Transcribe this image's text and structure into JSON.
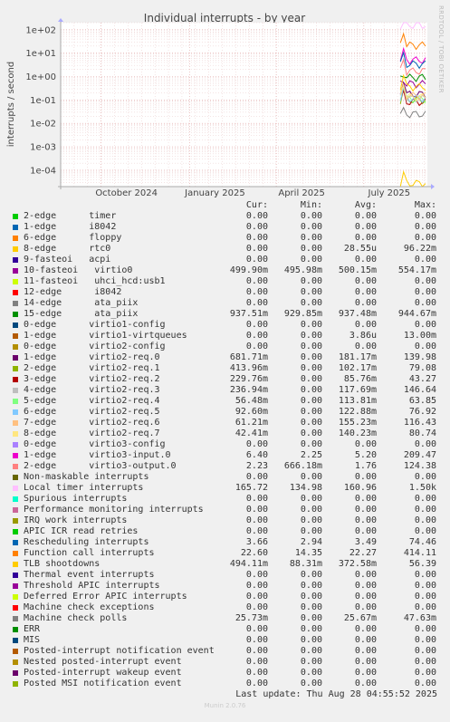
{
  "chart_data": {
    "type": "line",
    "title": "Individual interrupts - by year",
    "ylabel": "interrupts / second",
    "yscale": "log",
    "ylim": [
      2e-05,
      200
    ],
    "yticks": [
      "1e+02",
      "1e+01",
      "1e+00",
      "1e-01",
      "1e-02",
      "1e-03",
      "1e-04"
    ],
    "xticks": [
      "October 2024",
      "January 2025",
      "April 2025",
      "July 2025"
    ],
    "xlim": [
      "2024-08-20",
      "2025-09-05"
    ],
    "data_start": "2025-08-08",
    "grid": true
  },
  "side_text": "RRDTOOL / TOBI OETIKER",
  "legend": {
    "headers": {
      "cur": "Cur:",
      "min": "Min:",
      "avg": "Avg:",
      "max": "Max:"
    },
    "rows": [
      {
        "name": "2-edge      timer",
        "color": "#00cc00",
        "cur": "0.00",
        "min": "0.00",
        "avg": "0.00",
        "max": "0.00"
      },
      {
        "name": "1-edge      i8042",
        "color": "#0066b3",
        "cur": "0.00",
        "min": "0.00",
        "avg": "0.00",
        "max": "0.00"
      },
      {
        "name": "6-edge      floppy",
        "color": "#ff8000",
        "cur": "0.00",
        "min": "0.00",
        "avg": "0.00",
        "max": "0.00"
      },
      {
        "name": "8-edge      rtc0",
        "color": "#ffcc00",
        "cur": "0.00",
        "min": "0.00",
        "avg": "28.55u",
        "max": "96.22m"
      },
      {
        "name": "9-fasteoi   acpi",
        "color": "#330099",
        "cur": "0.00",
        "min": "0.00",
        "avg": "0.00",
        "max": "0.00"
      },
      {
        "name": "10-fasteoi   virtio0",
        "color": "#990099",
        "cur": "499.90m",
        "min": "495.98m",
        "avg": "500.15m",
        "max": "554.17m"
      },
      {
        "name": "11-fasteoi   uhci_hcd:usb1",
        "color": "#ccff00",
        "cur": "0.00",
        "min": "0.00",
        "avg": "0.00",
        "max": "0.00"
      },
      {
        "name": "12-edge      i8042",
        "color": "#ff0000",
        "cur": "0.00",
        "min": "0.00",
        "avg": "0.00",
        "max": "0.00"
      },
      {
        "name": "14-edge      ata_piix",
        "color": "#808080",
        "cur": "0.00",
        "min": "0.00",
        "avg": "0.00",
        "max": "0.00"
      },
      {
        "name": "15-edge      ata_piix",
        "color": "#008f00",
        "cur": "937.51m",
        "min": "929.85m",
        "avg": "937.48m",
        "max": "944.67m"
      },
      {
        "name": "0-edge      virtio1-config",
        "color": "#00487d",
        "cur": "0.00",
        "min": "0.00",
        "avg": "0.00",
        "max": "0.00"
      },
      {
        "name": "1-edge      virtio1-virtqueues",
        "color": "#b35a00",
        "cur": "0.00",
        "min": "0.00",
        "avg": "3.86u",
        "max": "13.00m"
      },
      {
        "name": "0-edge      virtio2-config",
        "color": "#b38f00",
        "cur": "0.00",
        "min": "0.00",
        "avg": "0.00",
        "max": "0.00"
      },
      {
        "name": "1-edge      virtio2-req.0",
        "color": "#6b006b",
        "cur": "681.71m",
        "min": "0.00",
        "avg": "181.17m",
        "max": "139.98"
      },
      {
        "name": "2-edge      virtio2-req.1",
        "color": "#8fb300",
        "cur": "413.96m",
        "min": "0.00",
        "avg": "102.17m",
        "max": "79.08"
      },
      {
        "name": "3-edge      virtio2-req.2",
        "color": "#b30000",
        "cur": "229.76m",
        "min": "0.00",
        "avg": "85.76m",
        "max": "43.27"
      },
      {
        "name": "4-edge      virtio2-req.3",
        "color": "#bebebe",
        "cur": "236.94m",
        "min": "0.00",
        "avg": "117.69m",
        "max": "146.64"
      },
      {
        "name": "5-edge      virtio2-req.4",
        "color": "#80ff80",
        "cur": "56.48m",
        "min": "0.00",
        "avg": "113.81m",
        "max": "63.85"
      },
      {
        "name": "6-edge      virtio2-req.5",
        "color": "#80c9ff",
        "cur": "92.60m",
        "min": "0.00",
        "avg": "122.88m",
        "max": "76.92"
      },
      {
        "name": "7-edge      virtio2-req.6",
        "color": "#ffc080",
        "cur": "61.21m",
        "min": "0.00",
        "avg": "155.23m",
        "max": "116.43"
      },
      {
        "name": "8-edge      virtio2-req.7",
        "color": "#ffe680",
        "cur": "42.41m",
        "min": "0.00",
        "avg": "140.23m",
        "max": "80.74"
      },
      {
        "name": "0-edge      virtio3-config",
        "color": "#aa80ff",
        "cur": "0.00",
        "min": "0.00",
        "avg": "0.00",
        "max": "0.00"
      },
      {
        "name": "1-edge      virtio3-input.0",
        "color": "#ee00cc",
        "cur": "6.40",
        "min": "2.25",
        "avg": "5.20",
        "max": "209.47"
      },
      {
        "name": "2-edge      virtio3-output.0",
        "color": "#ff8080",
        "cur": "2.23",
        "min": "666.18m",
        "avg": "1.76",
        "max": "124.38"
      },
      {
        "name": "Non-maskable interrupts",
        "color": "#666600",
        "cur": "0.00",
        "min": "0.00",
        "avg": "0.00",
        "max": "0.00"
      },
      {
        "name": "Local timer interrupts",
        "color": "#ffbfff",
        "cur": "165.72",
        "min": "134.98",
        "avg": "160.96",
        "max": "1.50k"
      },
      {
        "name": "Spurious interrupts",
        "color": "#00ffcc",
        "cur": "0.00",
        "min": "0.00",
        "avg": "0.00",
        "max": "0.00"
      },
      {
        "name": "Performance monitoring interrupts",
        "color": "#cc6699",
        "cur": "0.00",
        "min": "0.00",
        "avg": "0.00",
        "max": "0.00"
      },
      {
        "name": "IRQ work interrupts",
        "color": "#999900",
        "cur": "0.00",
        "min": "0.00",
        "avg": "0.00",
        "max": "0.00"
      },
      {
        "name": "APIC ICR read retries",
        "color": "#00cc00",
        "cur": "0.00",
        "min": "0.00",
        "avg": "0.00",
        "max": "0.00"
      },
      {
        "name": "Rescheduling interrupts",
        "color": "#0066b3",
        "cur": "3.66",
        "min": "2.94",
        "avg": "3.49",
        "max": "74.46"
      },
      {
        "name": "Function call interrupts",
        "color": "#ff8000",
        "cur": "22.60",
        "min": "14.35",
        "avg": "22.27",
        "max": "414.11"
      },
      {
        "name": "TLB shootdowns",
        "color": "#ffcc00",
        "cur": "494.11m",
        "min": "88.31m",
        "avg": "372.58m",
        "max": "56.39"
      },
      {
        "name": "Thermal event interrupts",
        "color": "#330099",
        "cur": "0.00",
        "min": "0.00",
        "avg": "0.00",
        "max": "0.00"
      },
      {
        "name": "Threshold APIC interrupts",
        "color": "#990099",
        "cur": "0.00",
        "min": "0.00",
        "avg": "0.00",
        "max": "0.00"
      },
      {
        "name": "Deferred Error APIC interrupts",
        "color": "#ccff00",
        "cur": "0.00",
        "min": "0.00",
        "avg": "0.00",
        "max": "0.00"
      },
      {
        "name": "Machine check exceptions",
        "color": "#ff0000",
        "cur": "0.00",
        "min": "0.00",
        "avg": "0.00",
        "max": "0.00"
      },
      {
        "name": "Machine check polls",
        "color": "#808080",
        "cur": "25.73m",
        "min": "0.00",
        "avg": "25.67m",
        "max": "47.63m"
      },
      {
        "name": "ERR",
        "color": "#008f00",
        "cur": "0.00",
        "min": "0.00",
        "avg": "0.00",
        "max": "0.00"
      },
      {
        "name": "MIS",
        "color": "#00487d",
        "cur": "0.00",
        "min": "0.00",
        "avg": "0.00",
        "max": "0.00"
      },
      {
        "name": "Posted-interrupt notification event",
        "color": "#b35a00",
        "cur": "0.00",
        "min": "0.00",
        "avg": "0.00",
        "max": "0.00"
      },
      {
        "name": "Nested posted-interrupt event",
        "color": "#b38f00",
        "cur": "0.00",
        "min": "0.00",
        "avg": "0.00",
        "max": "0.00"
      },
      {
        "name": "Posted-interrupt wakeup event",
        "color": "#6b006b",
        "cur": "0.00",
        "min": "0.00",
        "avg": "0.00",
        "max": "0.00"
      },
      {
        "name": "Posted MSI notification event",
        "color": "#8fb300",
        "cur": "0.00",
        "min": "0.00",
        "avg": "0.00",
        "max": "0.00"
      }
    ]
  },
  "footer": {
    "last_update": "Last update: Thu Aug 28 04:55:52 2025"
  },
  "munin_version": "Munin 2.0.76"
}
